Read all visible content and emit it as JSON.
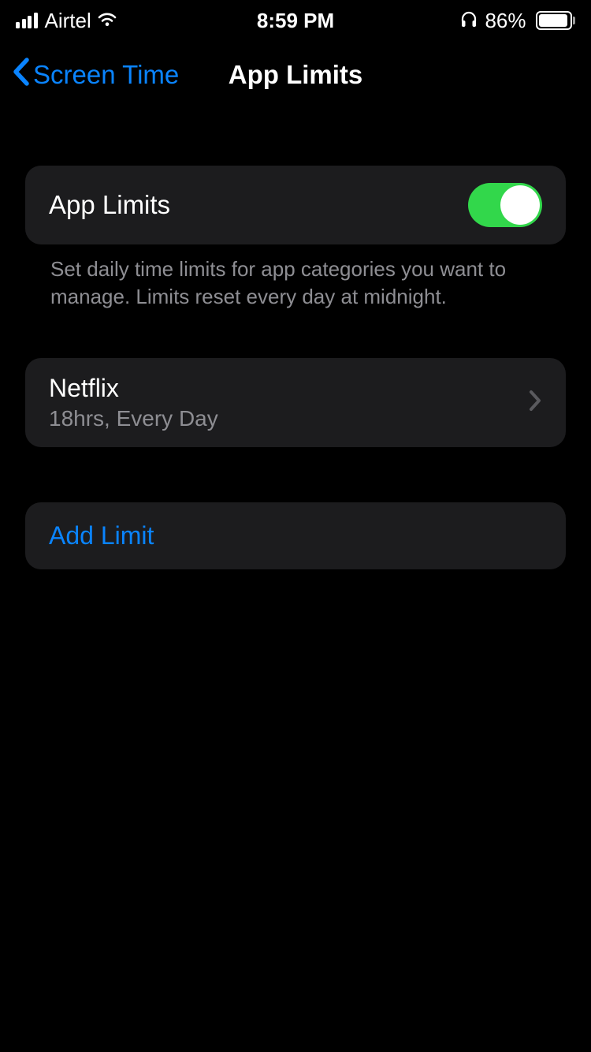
{
  "status_bar": {
    "carrier": "Airtel",
    "time": "8:59 PM",
    "battery_percent": "86%"
  },
  "nav": {
    "back_label": "Screen Time",
    "title": "App Limits"
  },
  "main_toggle": {
    "label": "App Limits",
    "on": true,
    "footer": "Set daily time limits for app categories you want to manage. Limits reset every day at midnight."
  },
  "limits": [
    {
      "title": "Netflix",
      "subtitle": "18hrs, Every Day"
    }
  ],
  "add_limit_label": "Add Limit"
}
